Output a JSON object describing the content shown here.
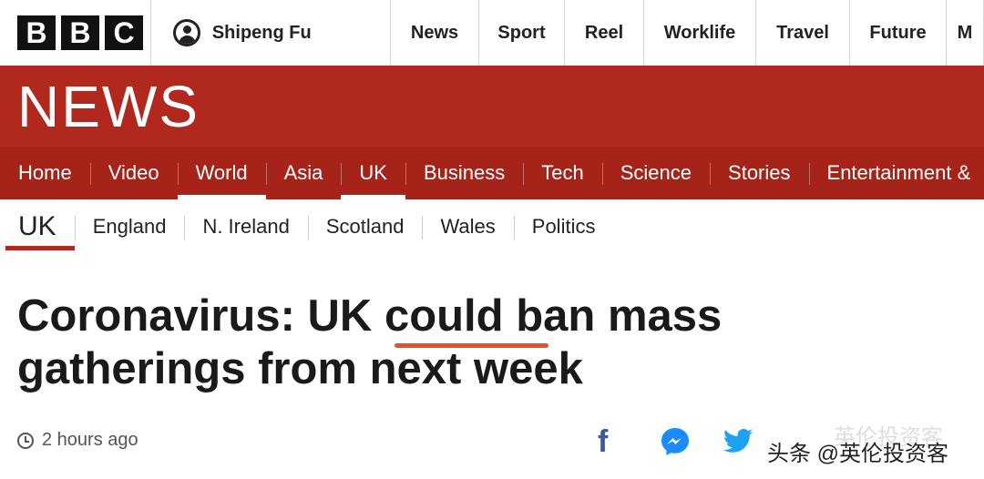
{
  "brand": {
    "logo_letters": [
      "B",
      "B",
      "C"
    ]
  },
  "account": {
    "name": "Shipeng Fu"
  },
  "top_nav": [
    {
      "label": "News",
      "width": 96
    },
    {
      "label": "Sport",
      "width": 93
    },
    {
      "label": "Reel",
      "width": 86
    },
    {
      "label": "Worklife",
      "width": 122
    },
    {
      "label": "Travel",
      "width": 102
    },
    {
      "label": "Future",
      "width": 105
    },
    {
      "label": "M",
      "width": 40
    }
  ],
  "news_logo": "NEWS",
  "section_nav": [
    {
      "label": "Home",
      "active": false
    },
    {
      "label": "Video",
      "active": false
    },
    {
      "label": "World",
      "active": true
    },
    {
      "label": "Asia",
      "active": false
    },
    {
      "label": "UK",
      "active": true
    },
    {
      "label": "Business",
      "active": false
    },
    {
      "label": "Tech",
      "active": false
    },
    {
      "label": "Science",
      "active": false
    },
    {
      "label": "Stories",
      "active": false
    },
    {
      "label": "Entertainment &",
      "active": false
    }
  ],
  "sub_nav": {
    "current": "UK",
    "items": [
      "England",
      "N. Ireland",
      "Scotland",
      "Wales",
      "Politics"
    ]
  },
  "article": {
    "headline_part1": "Coronavirus: UK ",
    "headline_emph": "could",
    "headline_part2": " ban mass gatherings from next week",
    "timestamp": "2 hours ago"
  },
  "share": {
    "icons": [
      "facebook-icon",
      "messenger-icon",
      "twitter-icon"
    ]
  },
  "watermark": {
    "text": "头条 @英伦投资客",
    "ghost": "英伦投资客"
  },
  "colors": {
    "brand_red": "#b0281e",
    "nav_red": "#a6231a",
    "highlight": "#e4522c"
  }
}
